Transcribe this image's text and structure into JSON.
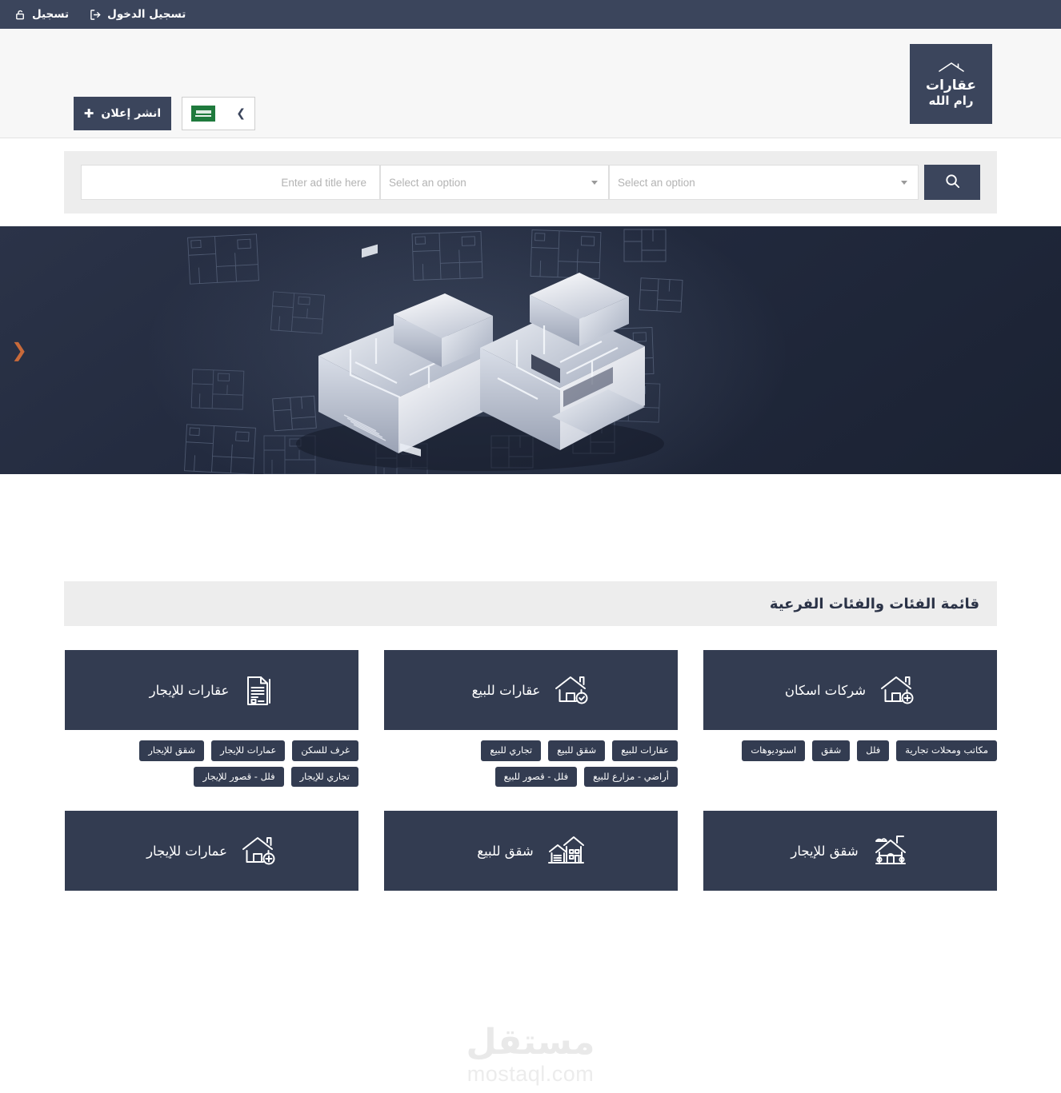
{
  "topbar": {
    "links": [
      {
        "label": "تسجيل الدخول",
        "icon": "login-icon"
      },
      {
        "label": "تسجيل",
        "icon": "signup-icon"
      }
    ]
  },
  "header": {
    "logo": {
      "line1": "عقارات",
      "line2": "رام الله",
      "icon": "house-roof-icon"
    },
    "publish_button": {
      "label": "انشر إعلان",
      "icon": "plus-icon"
    },
    "language_selector": {
      "flag": "saudi-flag",
      "chevron": "chevron-icon"
    }
  },
  "search": {
    "button_icon": "search-icon",
    "select_one_placeholder": "Select an option",
    "select_two_placeholder": "Select an option",
    "title_placeholder": "Enter ad title here",
    "title_value": ""
  },
  "hero": {
    "prev_arrow": "❮",
    "accent_color": "#c96a3a"
  },
  "categories": {
    "section_title": "قائمة الفئات والفئات الفرعية",
    "cards": [
      {
        "label": "شركات اسكان",
        "icon": "house-plus-icon",
        "tags": [
          "استوديوهات",
          "شقق",
          "فلل",
          "مكاتب ومحلات تجارية"
        ]
      },
      {
        "label": "عقارات للبيع",
        "icon": "house-check-icon",
        "tags": [
          "أراضي - مزارع للبيع",
          "تجاري للبيع",
          "شقق للبيع",
          "عقارات للبيع",
          "فلل - قصور للبيع"
        ]
      },
      {
        "label": "عقارات للإيجار",
        "icon": "contract-document-icon",
        "tags": [
          "تجاري للإيجار",
          "شقق للإيجار",
          "عمارات للإيجار",
          "غرف للسكن",
          "فلل - قصور للإيجار"
        ]
      },
      {
        "label": "شقق للإيجار",
        "icon": "cottage-icon",
        "tags": []
      },
      {
        "label": "شقق للبيع",
        "icon": "buildings-icon",
        "tags": []
      },
      {
        "label": "عمارات للإيجار",
        "icon": "house-plus-icon",
        "tags": []
      }
    ]
  },
  "watermark": {
    "arabic": "مستقل",
    "latin": "mostaql.com"
  },
  "colors": {
    "primary_dark": "#3b455c",
    "card_dark": "#333c51",
    "strip_gray": "#ededed",
    "header_gray": "#f7f7f7",
    "accent_orange": "#c96a3a"
  }
}
